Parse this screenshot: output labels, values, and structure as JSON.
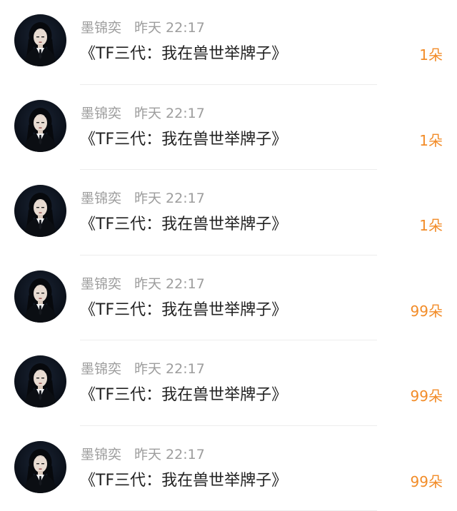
{
  "messages": [
    {
      "name": "墨锦奕",
      "day": "昨天",
      "time": "22:17",
      "text": "《TF三代：我在兽世举牌子》",
      "count": "1朵"
    },
    {
      "name": "墨锦奕",
      "day": "昨天",
      "time": "22:17",
      "text": "《TF三代：我在兽世举牌子》",
      "count": "1朵"
    },
    {
      "name": "墨锦奕",
      "day": "昨天",
      "time": "22:17",
      "text": "《TF三代：我在兽世举牌子》",
      "count": "1朵"
    },
    {
      "name": "墨锦奕",
      "day": "昨天",
      "time": "22:17",
      "text": "《TF三代：我在兽世举牌子》",
      "count": "99朵"
    },
    {
      "name": "墨锦奕",
      "day": "昨天",
      "time": "22:17",
      "text": "《TF三代：我在兽世举牌子》",
      "count": "99朵"
    },
    {
      "name": "墨锦奕",
      "day": "昨天",
      "time": "22:17",
      "text": "《TF三代：我在兽世举牌子》",
      "count": "99朵"
    }
  ],
  "colors": {
    "count": "#f28c28",
    "meta": "#9d9d9d",
    "text": "#222222"
  }
}
